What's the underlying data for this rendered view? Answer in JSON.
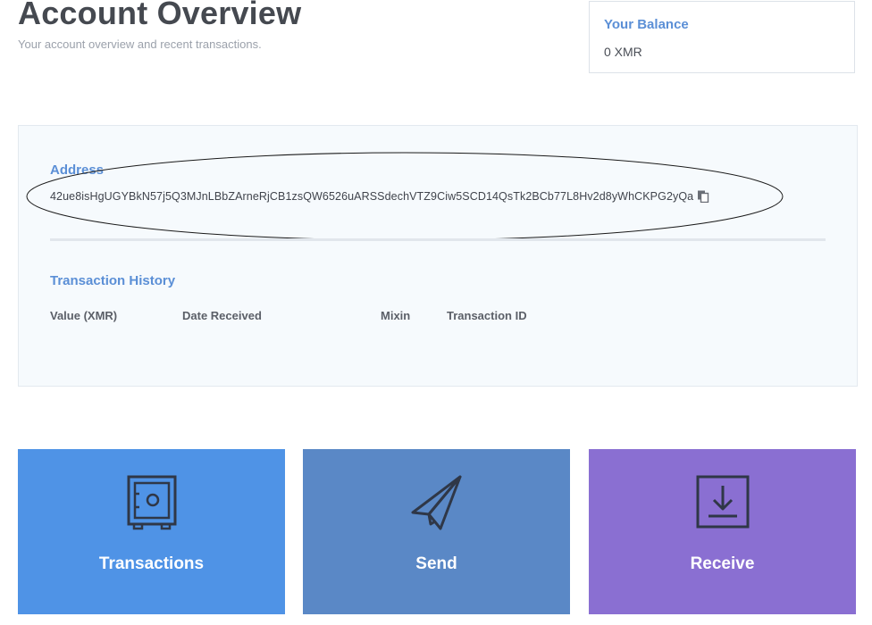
{
  "header": {
    "title": "Account Overview",
    "subtitle": "Your account overview and recent transactions."
  },
  "balance": {
    "title": "Your Balance",
    "value": "0 XMR"
  },
  "account": {
    "address_label": "Address",
    "address": "42ue8isHgUGYBkN57j5Q3MJnLBbZArneRjCB1zsQW6526uARSSdechVTZ9Ciw5SCD14QsTk2BCb77L8Hv2d8yWhCKPG2yQa",
    "copy_icon": "copy-icon"
  },
  "history": {
    "title": "Transaction History",
    "columns": [
      "Value (XMR)",
      "Date Received",
      "Mixin",
      "Transaction ID"
    ]
  },
  "actions": [
    {
      "label": "Transactions",
      "icon": "safe-icon",
      "color": "#4f93e6"
    },
    {
      "label": "Send",
      "icon": "paper-plane-icon",
      "color": "#5a88c6"
    },
    {
      "label": "Receive",
      "icon": "download-tray-icon",
      "color": "#8a6fd2"
    }
  ]
}
